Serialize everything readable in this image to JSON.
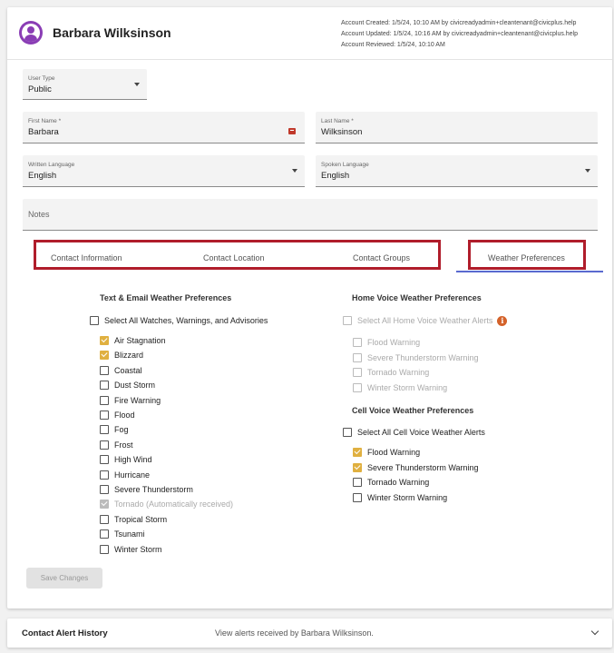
{
  "header": {
    "name": "Barbara Wilksinson",
    "meta": [
      "Account Created: 1/5/24, 10:10 AM by civicreadyadmin+cleantenant@civicplus.help",
      "Account Updated: 1/5/24, 10:16 AM by civicreadyadmin+cleantenant@civicplus.help",
      "Account Reviewed: 1/5/24, 10:10 AM"
    ]
  },
  "form": {
    "user_type": {
      "label": "User Type",
      "value": "Public"
    },
    "first_name": {
      "label": "First Name *",
      "value": "Barbara"
    },
    "last_name": {
      "label": "Last Name *",
      "value": "Wilksinson"
    },
    "written_language": {
      "label": "Written Language",
      "value": "English"
    },
    "spoken_language": {
      "label": "Spoken Language",
      "value": "English"
    },
    "notes": {
      "label": "Notes"
    }
  },
  "tabs": [
    "Contact Information",
    "Contact Location",
    "Contact Groups",
    "Weather Preferences"
  ],
  "text_email": {
    "title": "Text & Email Weather Preferences",
    "select_all": "Select All Watches, Warnings, and Advisories",
    "items": [
      {
        "label": "Air Stagnation",
        "state": "checked"
      },
      {
        "label": "Blizzard",
        "state": "checked"
      },
      {
        "label": "Coastal",
        "state": "unchecked"
      },
      {
        "label": "Dust Storm",
        "state": "unchecked"
      },
      {
        "label": "Fire Warning",
        "state": "unchecked"
      },
      {
        "label": "Flood",
        "state": "unchecked"
      },
      {
        "label": "Fog",
        "state": "unchecked"
      },
      {
        "label": "Frost",
        "state": "unchecked"
      },
      {
        "label": "High Wind",
        "state": "unchecked"
      },
      {
        "label": "Hurricane",
        "state": "unchecked"
      },
      {
        "label": "Severe Thunderstorm",
        "state": "unchecked"
      },
      {
        "label": "Tornado (Automatically received)",
        "state": "disabled-checked"
      },
      {
        "label": "Tropical Storm",
        "state": "unchecked"
      },
      {
        "label": "Tsunami",
        "state": "unchecked"
      },
      {
        "label": "Winter Storm",
        "state": "unchecked"
      }
    ]
  },
  "home_voice": {
    "title": "Home Voice Weather Preferences",
    "select_all": "Select All Home Voice Weather Alerts",
    "info_icon": "i",
    "items": [
      {
        "label": "Flood Warning",
        "state": "disabled"
      },
      {
        "label": "Severe Thunderstorm Warning",
        "state": "disabled"
      },
      {
        "label": "Tornado Warning",
        "state": "disabled"
      },
      {
        "label": "Winter Storm Warning",
        "state": "disabled"
      }
    ]
  },
  "cell_voice": {
    "title": "Cell Voice Weather Preferences",
    "select_all": "Select All Cell Voice Weather Alerts",
    "items": [
      {
        "label": "Flood Warning",
        "state": "checked"
      },
      {
        "label": "Severe Thunderstorm Warning",
        "state": "checked"
      },
      {
        "label": "Tornado Warning",
        "state": "unchecked"
      },
      {
        "label": "Winter Storm Warning",
        "state": "unchecked"
      }
    ]
  },
  "save_label": "Save Changes",
  "history": {
    "title": "Contact Alert History",
    "description": "View alerts received by Barbara Wilksinson."
  },
  "colors": {
    "accent": "#8a3db5",
    "checkbox_checked": "#e0b040",
    "highlight_box": "#b01d2b",
    "tab_underline": "#5a6acf",
    "info_icon": "#d4622a"
  }
}
